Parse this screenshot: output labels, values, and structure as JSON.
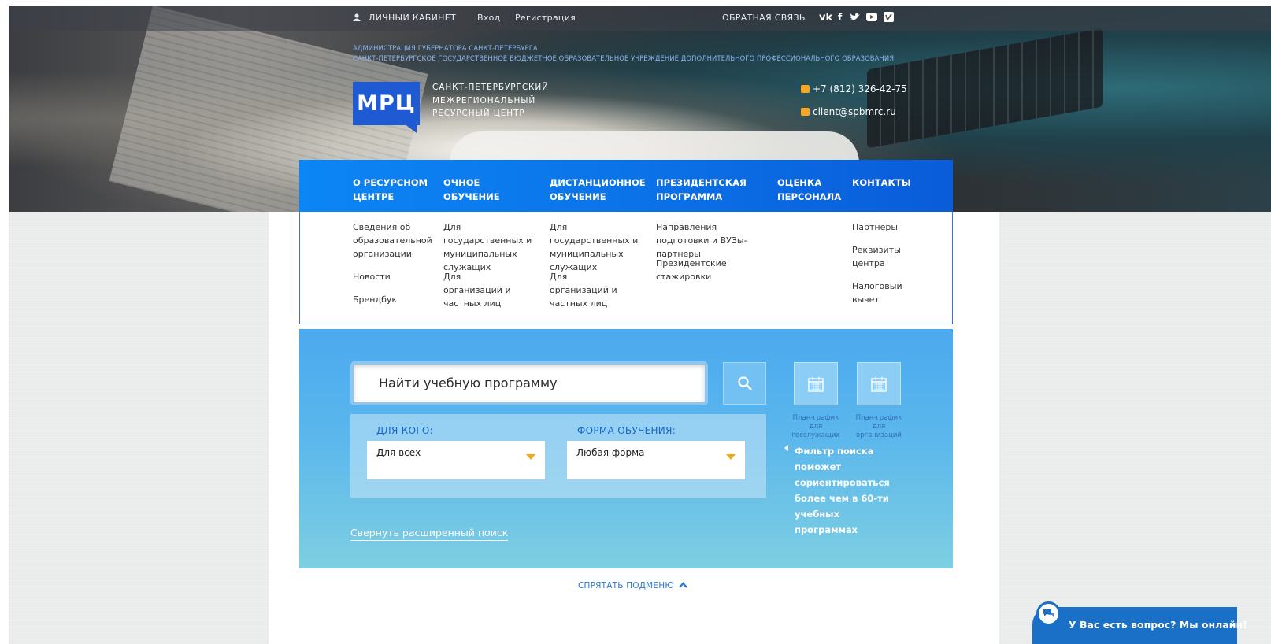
{
  "topbar": {
    "account": "ЛИЧНЫЙ КАБИНЕТ",
    "login": "Вход",
    "register": "Регистрация",
    "feedback": "ОБРАТНАЯ СВЯЗЬ",
    "social": [
      "vk-icon",
      "facebook-icon",
      "twitter-icon",
      "youtube-icon",
      "vimeo-icon"
    ]
  },
  "header": {
    "admin_line1": "АДМИНИСТРАЦИЯ ГУБЕРНАТОРА САНКТ-ПЕТЕРБУРГА",
    "admin_line2": "САНКТ-ПЕТЕРБУРГСКОЕ ГОСУДАРСТВЕННОЕ БЮДЖЕТНОЕ ОБРАЗОВАТЕЛЬНОЕ УЧРЕЖДЕНИЕ ДОПОЛНИТЕЛЬНОГО ПРОФЕССИОНАЛЬНОГО ОБРАЗОВАНИЯ",
    "logo_text": "МРЦ",
    "name_line1": "САНКТ-ПЕТЕРБУРГСКИЙ",
    "name_line2": "МЕЖРЕГИОНАЛЬНЫЙ",
    "name_line3": "РЕСУРСНЫЙ ЦЕНТР",
    "phone": "+7 (812) 326-42-75",
    "email": "client@spbmrc.ru"
  },
  "nav": {
    "items": [
      {
        "l1": "О РЕСУРСНОМ",
        "l2": "ЦЕНТРЕ"
      },
      {
        "l1": "ОЧНОЕ",
        "l2": "ОБУЧЕНИЕ"
      },
      {
        "l1": "ДИСТАНЦИОННОЕ",
        "l2": "ОБУЧЕНИЕ"
      },
      {
        "l1": "ПРЕЗИДЕНТСКАЯ",
        "l2": "ПРОГРАММА"
      },
      {
        "l1": "ОЦЕНКА",
        "l2": "ПЕРСОНАЛА"
      },
      {
        "l1": "КОНТАКТЫ",
        "l2": ""
      }
    ]
  },
  "submenu": {
    "col1": [
      "Сведения об образовательной организации",
      "Новости",
      "Брендбук"
    ],
    "col2": [
      "Для государственных и муниципальных служащих",
      "Для организаций и частных лиц"
    ],
    "col3": [
      "Для государственных и муниципальных служащих",
      "Для организаций и частных лиц"
    ],
    "col4": [
      "Направления подготовки и ВУЗы-партнеры",
      "Президентские стажировки"
    ],
    "col6": [
      "Партнеры",
      "Реквизиты центра",
      "Налоговый вычет"
    ]
  },
  "search": {
    "placeholder": "Найти учебную программу",
    "who_label": "ДЛЯ КОГО:",
    "who_value": "Для всех",
    "form_label": "ФОРМА ОБУЧЕНИЯ:",
    "form_value": "Любая форма",
    "plan1": "План-график для госслужащих",
    "plan2": "План-график для организаций",
    "hint": "Фильтр поиска поможет сориентироваться более чем в 60-ти учебных программах",
    "collapse": "Свернуть расширенный поиск"
  },
  "hide_submenu": "СПРЯТАТЬ ПОДМЕНЮ",
  "chat": {
    "label": "У Вас есть вопрос? Мы онлайн!"
  },
  "colors": {
    "accent": "#0b73e8",
    "logo": "#1e5bd3",
    "icon_accent": "#f5a623"
  }
}
